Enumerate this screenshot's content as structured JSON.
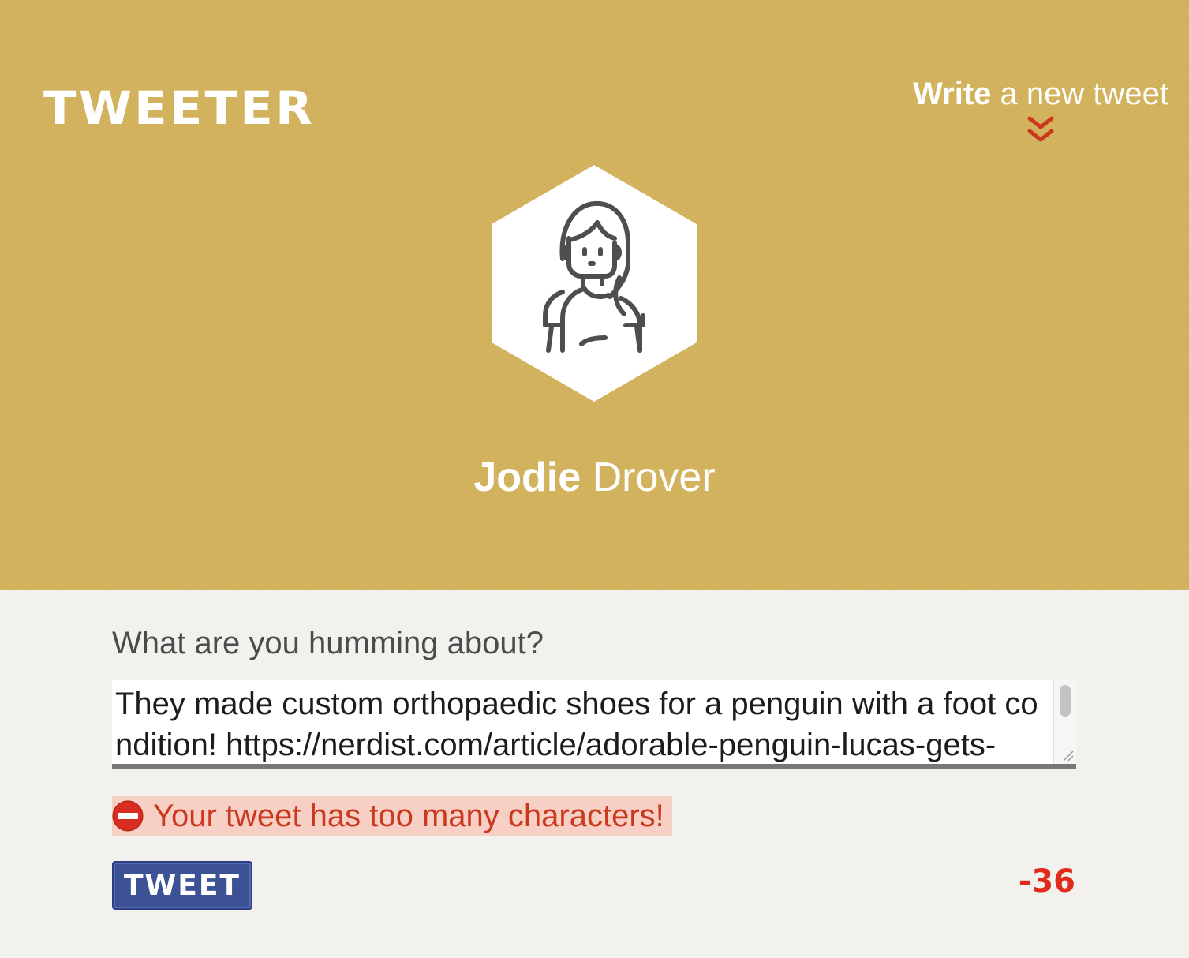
{
  "header": {
    "brand": "Tweeter",
    "write_link": {
      "strong": "Write",
      "rest": "a new tweet"
    }
  },
  "profile": {
    "avatar_icon": "woman-avatar-icon",
    "first_name": "Jodie",
    "last_name": "Drover"
  },
  "composer": {
    "prompt": "What are you humming about?",
    "tweet_text": "They made custom orthopaedic shoes for a penguin with a foot condition! https://nerdist.com/article/adorable-penguin-lucas-gets-",
    "error_icon": "no-entry-icon",
    "error_message": "Your tweet has too many characters!",
    "submit_label": "TWEET",
    "char_counter": "-36"
  },
  "colors": {
    "hero_background": "#d2b25c",
    "accent_red": "#c9391e",
    "counter_red": "#e02b1a",
    "button_blue": "#3d5294",
    "error_background": "#f8cfc4"
  }
}
